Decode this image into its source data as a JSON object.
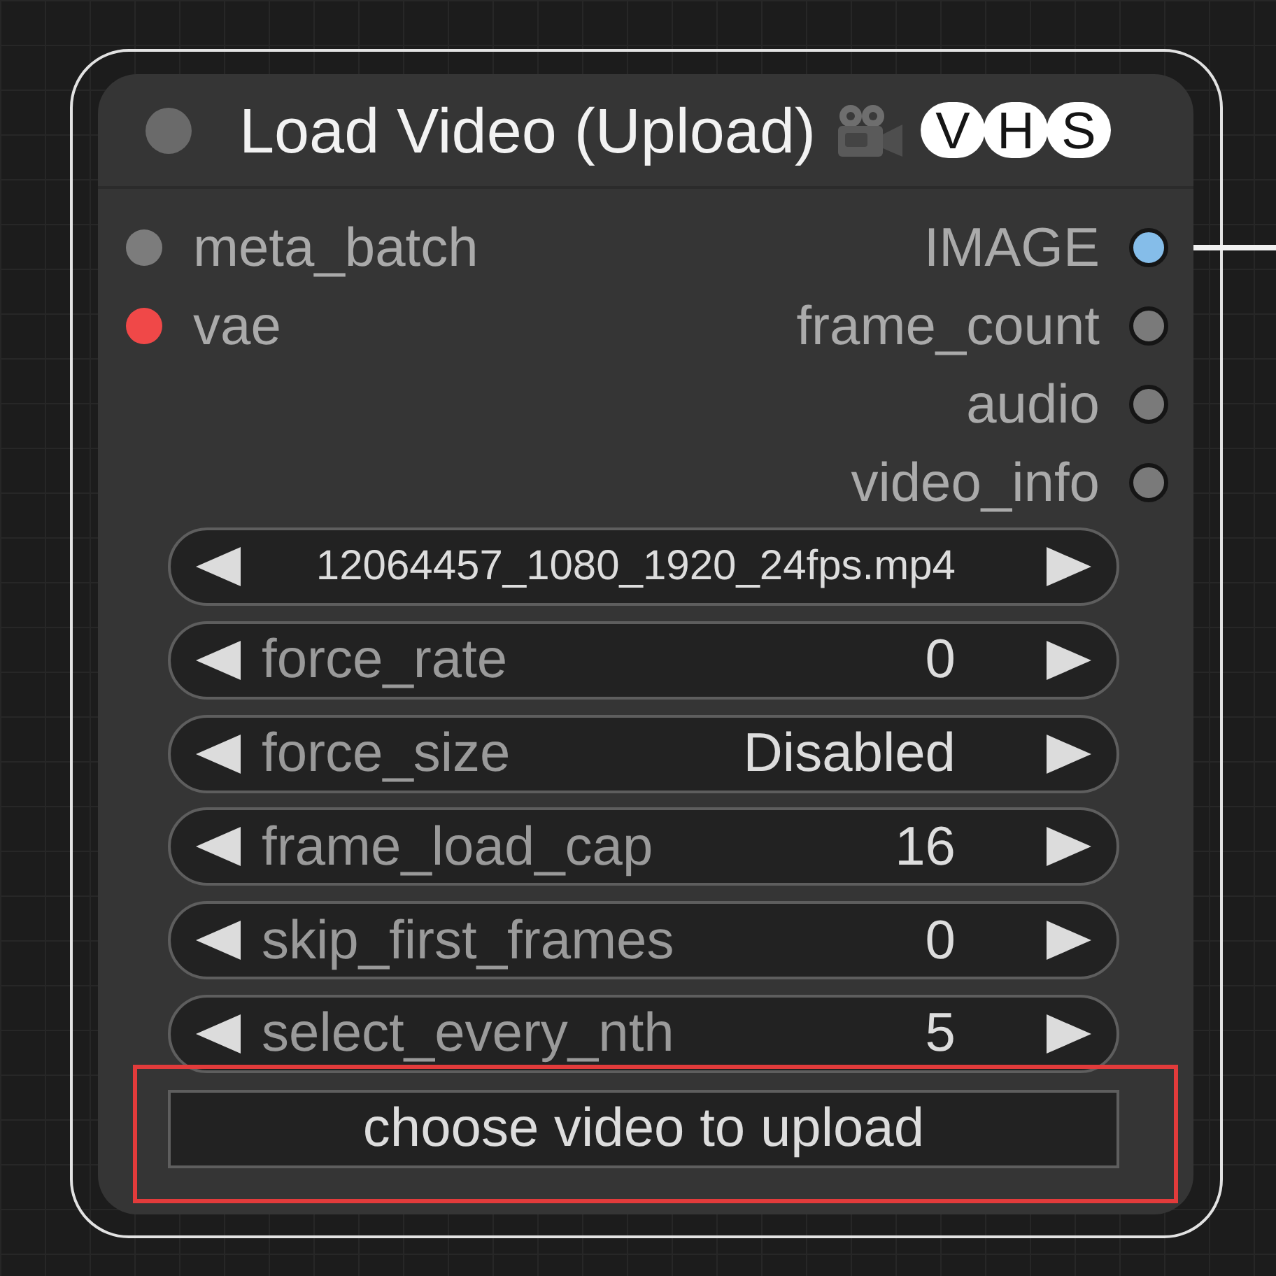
{
  "node": {
    "title": "Load Video (Upload)",
    "badges": [
      "V",
      "H",
      "S"
    ]
  },
  "inputs": [
    {
      "label": "meta_batch",
      "color": "#7c7c7c"
    },
    {
      "label": "vae",
      "color": "#f04848"
    }
  ],
  "outputs": [
    {
      "label": "IMAGE",
      "color": "#85bde9",
      "connected": true
    },
    {
      "label": "frame_count",
      "color": "#7a7a7a"
    },
    {
      "label": "audio",
      "color": "#7a7a7a"
    },
    {
      "label": "video_info",
      "color": "#7a7a7a"
    }
  ],
  "widgets": [
    {
      "value": "12064457_1080_1920_24fps.mp4"
    },
    {
      "label": "force_rate",
      "value": "0"
    },
    {
      "label": "force_size",
      "value": "Disabled"
    },
    {
      "label": "frame_load_cap",
      "value": "16"
    },
    {
      "label": "skip_first_frames",
      "value": "0"
    },
    {
      "label": "select_every_nth",
      "value": "5"
    }
  ],
  "upload_button": {
    "label": "choose video to upload",
    "highlighted": true
  }
}
